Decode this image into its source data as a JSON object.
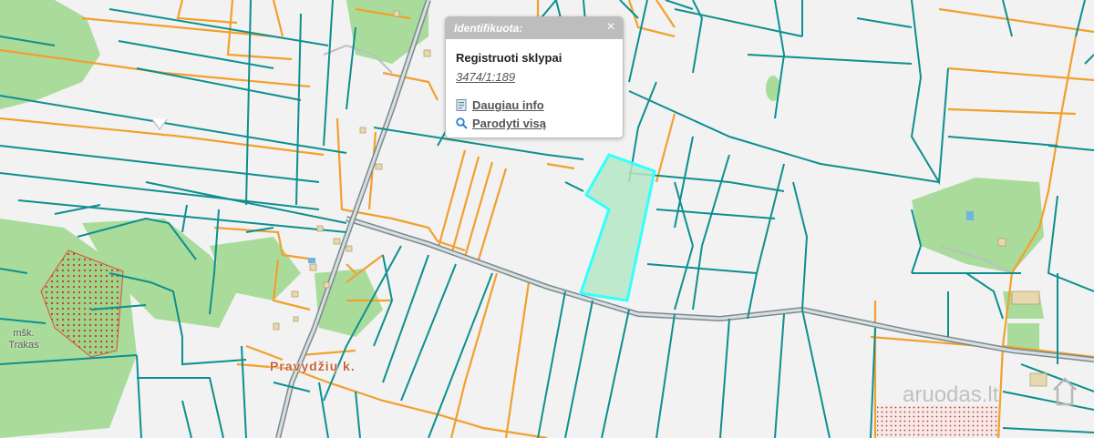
{
  "popup": {
    "title": "Identifikuota:",
    "close_glyph": "×",
    "layer_name": "Registruoti sklypai",
    "parcel_id": "3474/1:189",
    "more_info_label": "Daugiau info",
    "show_all_label": "Parodyti visą",
    "icons": {
      "more_info": "document-icon",
      "show_all": "magnifier-icon"
    }
  },
  "labels": {
    "village": "Pravydžių k.",
    "forest_line1": "mšk.",
    "forest_line2": "Trakas"
  },
  "watermark": "aruodas.lt",
  "colors": {
    "background": "#f2f2f2",
    "parcel_boundary": "#0e8f8f",
    "cadastral_boundary": "#f2a02c",
    "forest": "#a9dc9a",
    "highlight": "#33ffff",
    "road": "#a8b4b8"
  }
}
